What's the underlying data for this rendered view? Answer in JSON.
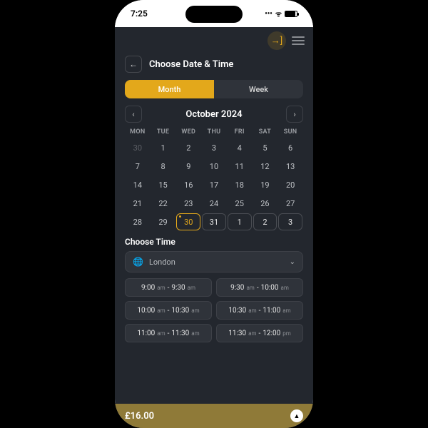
{
  "statusbar": {
    "time": "7:25"
  },
  "header": {
    "title": "Choose Date & Time"
  },
  "tabs": {
    "month": "Month",
    "week": "Week"
  },
  "calendar": {
    "month_label": "October 2024",
    "weekdays": [
      "MON",
      "TUE",
      "WED",
      "THU",
      "FRI",
      "SAT",
      "SUN"
    ],
    "rows": [
      [
        {
          "n": "30",
          "cls": "other"
        },
        {
          "n": "1"
        },
        {
          "n": "2"
        },
        {
          "n": "3"
        },
        {
          "n": "4"
        },
        {
          "n": "5"
        },
        {
          "n": "6"
        }
      ],
      [
        {
          "n": "7"
        },
        {
          "n": "8"
        },
        {
          "n": "9"
        },
        {
          "n": "10"
        },
        {
          "n": "11"
        },
        {
          "n": "12"
        },
        {
          "n": "13"
        }
      ],
      [
        {
          "n": "14"
        },
        {
          "n": "15"
        },
        {
          "n": "16"
        },
        {
          "n": "17"
        },
        {
          "n": "18"
        },
        {
          "n": "19"
        },
        {
          "n": "20"
        }
      ],
      [
        {
          "n": "21"
        },
        {
          "n": "22"
        },
        {
          "n": "23"
        },
        {
          "n": "24"
        },
        {
          "n": "25"
        },
        {
          "n": "26"
        },
        {
          "n": "27"
        }
      ],
      [
        {
          "n": "28"
        },
        {
          "n": "29"
        },
        {
          "n": "30",
          "cls": "selected dot"
        },
        {
          "n": "31",
          "cls": "boxed"
        },
        {
          "n": "1",
          "cls": "boxed"
        },
        {
          "n": "2",
          "cls": "boxed"
        },
        {
          "n": "3",
          "cls": "boxed"
        }
      ]
    ]
  },
  "time_section": {
    "label": "Choose Time",
    "timezone": "London"
  },
  "timeslots": [
    {
      "s": "9:00",
      "sp": "am",
      "e": "9:30",
      "ep": "am"
    },
    {
      "s": "9:30",
      "sp": "am",
      "e": "10:00",
      "ep": "am"
    },
    {
      "s": "10:00",
      "sp": "am",
      "e": "10:30",
      "ep": "am"
    },
    {
      "s": "10:30",
      "sp": "am",
      "e": "11:00",
      "ep": "am"
    },
    {
      "s": "11:00",
      "sp": "am",
      "e": "11:30",
      "ep": "am"
    },
    {
      "s": "11:30",
      "sp": "am",
      "e": "12:00",
      "ep": "pm"
    }
  ],
  "footer": {
    "price": "£16.00"
  },
  "icons": {
    "back": "←",
    "prev": "‹",
    "next": "›",
    "globe": "🌐",
    "chev": "⌄",
    "login": "→]"
  }
}
